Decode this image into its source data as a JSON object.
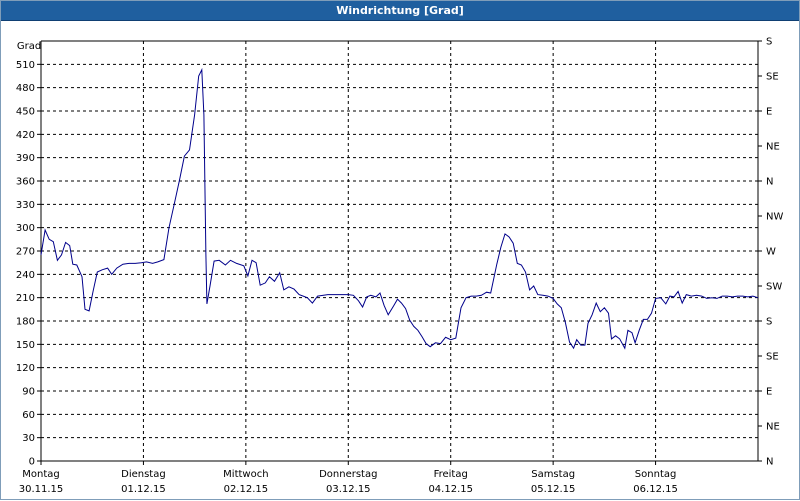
{
  "window": {
    "title": "Windrichtung [Grad]"
  },
  "colors": {
    "titlebar": "#1f5f9f",
    "line": "#00008b",
    "grid": "#000000"
  },
  "chart_data": {
    "type": "line",
    "title": "Windrichtung [Grad]",
    "ylabel": "Grad",
    "ylim": [
      0,
      540
    ],
    "yticks": [
      0,
      30,
      60,
      90,
      120,
      150,
      180,
      210,
      240,
      270,
      300,
      330,
      360,
      390,
      420,
      450,
      480,
      510
    ],
    "xlim": [
      0,
      7
    ],
    "xticks": [
      {
        "day": "Montag",
        "date": "30.11.15"
      },
      {
        "day": "Dienstag",
        "date": "01.12.15"
      },
      {
        "day": "Mittwoch",
        "date": "02.12.15"
      },
      {
        "day": "Donnerstag",
        "date": "03.12.15"
      },
      {
        "day": "Freitag",
        "date": "04.12.15"
      },
      {
        "day": "Samstag",
        "date": "05.12.15"
      },
      {
        "day": "Sonntag",
        "date": "06.12.15"
      }
    ],
    "right_axis": [
      "S",
      "SE",
      "E",
      "NE",
      "N",
      "NW",
      "W",
      "SW",
      "S",
      "SE",
      "E",
      "NE",
      "N"
    ],
    "grid": true,
    "series": [
      {
        "name": "",
        "points": [
          [
            0.0,
            265
          ],
          [
            0.04,
            297
          ],
          [
            0.08,
            285
          ],
          [
            0.12,
            282
          ],
          [
            0.16,
            258
          ],
          [
            0.2,
            265
          ],
          [
            0.24,
            281
          ],
          [
            0.28,
            277
          ],
          [
            0.31,
            253
          ],
          [
            0.35,
            252
          ],
          [
            0.4,
            237
          ],
          [
            0.43,
            195
          ],
          [
            0.47,
            193
          ],
          [
            0.51,
            219
          ],
          [
            0.55,
            243
          ],
          [
            0.6,
            246
          ],
          [
            0.65,
            248
          ],
          [
            0.69,
            240
          ],
          [
            0.74,
            248
          ],
          [
            0.8,
            253
          ],
          [
            0.86,
            254
          ],
          [
            0.92,
            254
          ],
          [
            0.98,
            255
          ],
          [
            1.03,
            256
          ],
          [
            1.09,
            254
          ],
          [
            1.14,
            256
          ],
          [
            1.2,
            259
          ],
          [
            1.25,
            300
          ],
          [
            1.3,
            330
          ],
          [
            1.35,
            360
          ],
          [
            1.4,
            392
          ],
          [
            1.45,
            400
          ],
          [
            1.5,
            445
          ],
          [
            1.54,
            495
          ],
          [
            1.57,
            503
          ],
          [
            1.59,
            445
          ],
          [
            1.61,
            265
          ],
          [
            1.62,
            202
          ],
          [
            1.65,
            225
          ],
          [
            1.69,
            257
          ],
          [
            1.74,
            258
          ],
          [
            1.8,
            252
          ],
          [
            1.85,
            258
          ],
          [
            1.91,
            254
          ],
          [
            1.98,
            251
          ],
          [
            2.02,
            238
          ],
          [
            2.06,
            258
          ],
          [
            2.1,
            255
          ],
          [
            2.14,
            226
          ],
          [
            2.19,
            229
          ],
          [
            2.23,
            237
          ],
          [
            2.28,
            231
          ],
          [
            2.33,
            242
          ],
          [
            2.37,
            220
          ],
          [
            2.42,
            224
          ],
          [
            2.47,
            221
          ],
          [
            2.52,
            214
          ],
          [
            2.56,
            212
          ],
          [
            2.6,
            210
          ],
          [
            2.65,
            203
          ],
          [
            2.7,
            212
          ],
          [
            2.8,
            214
          ],
          [
            2.9,
            214
          ],
          [
            3.0,
            214
          ],
          [
            3.05,
            213
          ],
          [
            3.1,
            206
          ],
          [
            3.14,
            198
          ],
          [
            3.18,
            211
          ],
          [
            3.22,
            213
          ],
          [
            3.27,
            211
          ],
          [
            3.31,
            216
          ],
          [
            3.35,
            200
          ],
          [
            3.39,
            188
          ],
          [
            3.44,
            199
          ],
          [
            3.48,
            208
          ],
          [
            3.52,
            203
          ],
          [
            3.56,
            196
          ],
          [
            3.6,
            181
          ],
          [
            3.64,
            173
          ],
          [
            3.68,
            168
          ],
          [
            3.72,
            160
          ],
          [
            3.76,
            151
          ],
          [
            3.8,
            147
          ],
          [
            3.85,
            152
          ],
          [
            3.9,
            151
          ],
          [
            3.95,
            159
          ],
          [
            4.0,
            156
          ],
          [
            4.05,
            158
          ],
          [
            4.1,
            197
          ],
          [
            4.15,
            210
          ],
          [
            4.2,
            212
          ],
          [
            4.25,
            212
          ],
          [
            4.3,
            213
          ],
          [
            4.35,
            217
          ],
          [
            4.39,
            216
          ],
          [
            4.45,
            253
          ],
          [
            4.49,
            275
          ],
          [
            4.53,
            292
          ],
          [
            4.57,
            288
          ],
          [
            4.61,
            280
          ],
          [
            4.65,
            254
          ],
          [
            4.69,
            252
          ],
          [
            4.73,
            243
          ],
          [
            4.77,
            220
          ],
          [
            4.81,
            225
          ],
          [
            4.85,
            214
          ],
          [
            4.9,
            213
          ],
          [
            4.95,
            212
          ],
          [
            5.0,
            209
          ],
          [
            5.04,
            202
          ],
          [
            5.08,
            197
          ],
          [
            5.12,
            178
          ],
          [
            5.16,
            153
          ],
          [
            5.2,
            145
          ],
          [
            5.23,
            156
          ],
          [
            5.27,
            149
          ],
          [
            5.31,
            149
          ],
          [
            5.34,
            177
          ],
          [
            5.38,
            188
          ],
          [
            5.42,
            203
          ],
          [
            5.46,
            192
          ],
          [
            5.5,
            197
          ],
          [
            5.54,
            190
          ],
          [
            5.57,
            157
          ],
          [
            5.61,
            161
          ],
          [
            5.65,
            157
          ],
          [
            5.7,
            145
          ],
          [
            5.73,
            168
          ],
          [
            5.77,
            165
          ],
          [
            5.8,
            152
          ],
          [
            5.84,
            168
          ],
          [
            5.88,
            182
          ],
          [
            5.92,
            182
          ],
          [
            5.96,
            190
          ],
          [
            6.0,
            209
          ],
          [
            6.05,
            210
          ],
          [
            6.1,
            202
          ],
          [
            6.14,
            212
          ],
          [
            6.18,
            211
          ],
          [
            6.22,
            218
          ],
          [
            6.26,
            203
          ],
          [
            6.3,
            214
          ],
          [
            6.35,
            212
          ],
          [
            6.4,
            213
          ],
          [
            6.45,
            212
          ],
          [
            6.5,
            209
          ],
          [
            6.55,
            210
          ],
          [
            6.6,
            209
          ],
          [
            6.65,
            212
          ],
          [
            6.7,
            212
          ],
          [
            6.75,
            211
          ],
          [
            6.8,
            212
          ],
          [
            6.85,
            212
          ],
          [
            6.9,
            211
          ],
          [
            6.95,
            212
          ],
          [
            7.0,
            210
          ]
        ]
      }
    ]
  }
}
